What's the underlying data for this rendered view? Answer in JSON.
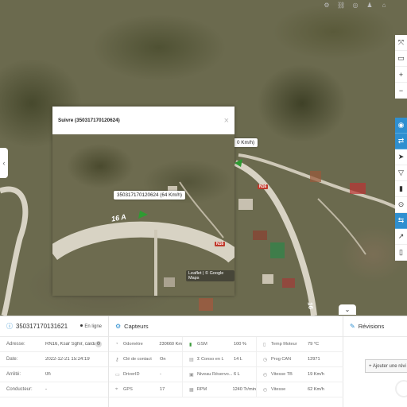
{
  "topbar": {
    "icons": [
      "settings-icon",
      "link-icon",
      "target-icon",
      "user-icon",
      "lock-icon"
    ],
    "flag_colors": [
      "#1a3f9b",
      "#ffffff",
      "#d22a2a"
    ]
  },
  "map": {
    "route_label": "N16",
    "road_shield": "N16",
    "route_label_2": "16",
    "side_tooltip": "0 Km/h)",
    "colors": {
      "road": "#d8d3c4",
      "marker": "#2e9b32",
      "accent": "#2f8fd0"
    }
  },
  "popup": {
    "title": "Suivre (350317170120624)",
    "close": "×",
    "tooltip": "350317170120624 (64 Km/h)",
    "route_label": "16 A",
    "shield": "N16",
    "attribution": "Leaflet | © Google Maps"
  },
  "toolbar": {
    "buttons": [
      "fullscreen-icon",
      "book-icon",
      "zoom-in-icon",
      "zoom-out-icon",
      "target-icon",
      "shuffle-icon",
      "navigate-icon",
      "filter-icon",
      "road-icon",
      "pin-icon",
      "share-icon",
      "direction-icon",
      "battery-icon"
    ]
  },
  "vehicle": {
    "id": "350317170131621",
    "status": "En ligne",
    "rows": [
      {
        "key": "Adresse:",
        "value": "RN16, Ksar Sghir, caïda..."
      },
      {
        "key": "Date:",
        "value": "2022-12-21 15:24:19"
      },
      {
        "key": "Arrêté:",
        "value": "0h"
      },
      {
        "key": "Conducteur:",
        "value": "-"
      }
    ]
  },
  "sensors": {
    "title": "Capteurs",
    "rows": [
      [
        {
          "icon": "speedometer-icon",
          "label": "Odomètre",
          "value": "230660 Km"
        },
        {
          "icon": "signal-icon",
          "label": "GSM",
          "value": "100 %"
        },
        {
          "icon": "thermometer-icon",
          "label": "Temp Moteur",
          "value": "79 °C"
        }
      ],
      [
        {
          "icon": "key-icon",
          "label": "Clé de contact",
          "value": "On"
        },
        {
          "icon": "fuel-icon",
          "label": "Σ Conso en L",
          "value": "14 L"
        },
        {
          "icon": "gauge-icon",
          "label": "Prog CAN",
          "value": "12971"
        }
      ],
      [
        {
          "icon": "id-icon",
          "label": "DriverID",
          "value": "-"
        },
        {
          "icon": "tank-icon",
          "label": "Niveau Réservo...",
          "value": "6 L"
        },
        {
          "icon": "speed-icon",
          "label": "Vitesse TB",
          "value": "19 Km/h"
        }
      ],
      [
        {
          "icon": "gps-icon",
          "label": "GPS",
          "value": "17"
        },
        {
          "icon": "rpm-icon",
          "label": "RPM",
          "value": "1240 Tr/min"
        },
        {
          "icon": "speed-icon",
          "label": "Vitesse",
          "value": "62 Km/h"
        }
      ]
    ]
  },
  "revisions": {
    "title": "Révisions",
    "add_button": "+ Ajouter une révi"
  }
}
